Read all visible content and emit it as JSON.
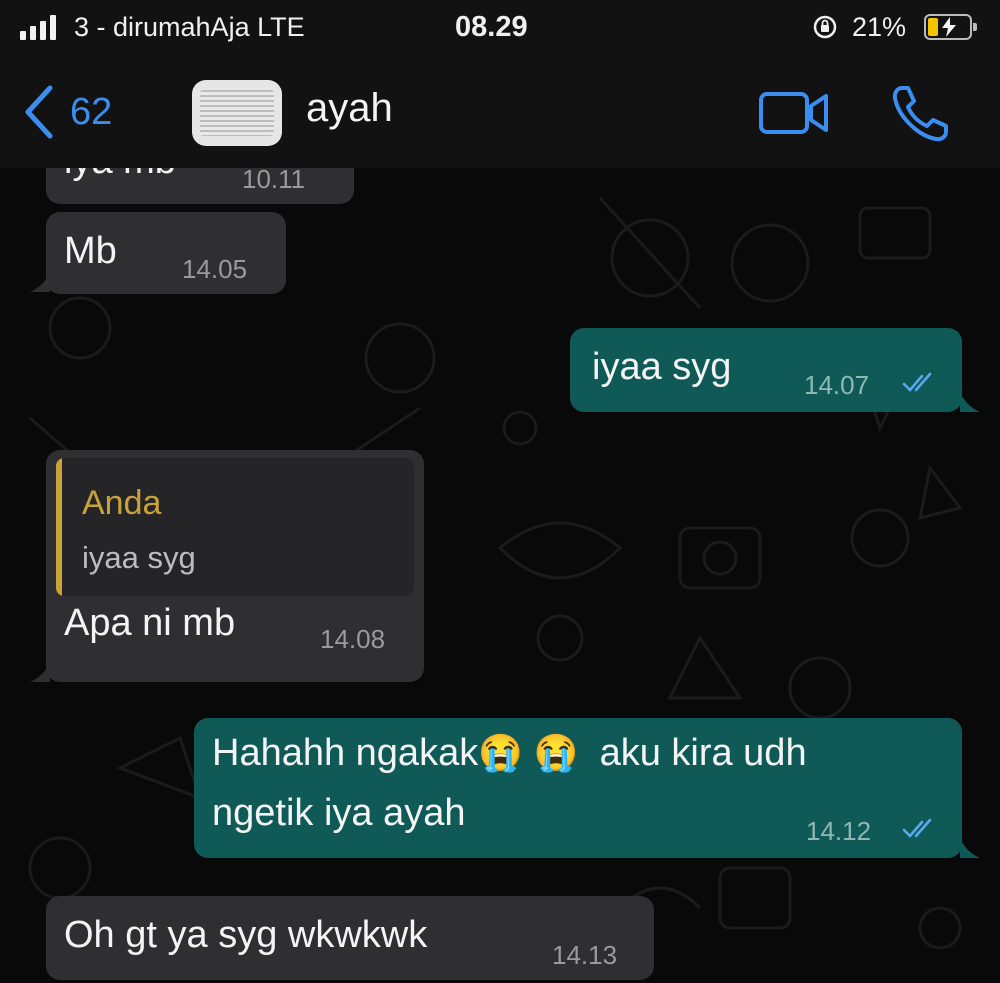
{
  "status": {
    "carrier": "3 - dirumahAja  LTE",
    "time": "08.29",
    "battery": "21%",
    "battery_level": 0.21
  },
  "header": {
    "back_count": "62",
    "contact_name": "ayah",
    "icons": [
      "chevron-left-icon",
      "video-call-icon",
      "phone-icon"
    ]
  },
  "messages": [
    {
      "direction": "in",
      "text": "iya mb",
      "time": "10.11"
    },
    {
      "direction": "in",
      "text": "Mb",
      "time": "14.05"
    },
    {
      "direction": "out",
      "text": "iyaa syg",
      "time": "14.07",
      "read": true
    },
    {
      "direction": "in",
      "reply_to": {
        "author": "Anda",
        "text": "iyaa syg"
      },
      "text": "Apa ni mb",
      "time": "14.08"
    },
    {
      "direction": "out",
      "text_line1_a": "Hahahh ngakak",
      "emoji": "😭",
      "text_line1_b": "aku kira udh",
      "text_line2": "ngetik iya ayah",
      "time": "14.12",
      "read": true
    },
    {
      "direction": "in",
      "text": "Oh gt ya syg wkwkwk",
      "time": "14.13"
    }
  ],
  "colors": {
    "accent": "#3b8ef0",
    "bubble_in": "#2f2f31",
    "bubble_out": "#0f5a57",
    "quote_author": "#c8a23a"
  }
}
